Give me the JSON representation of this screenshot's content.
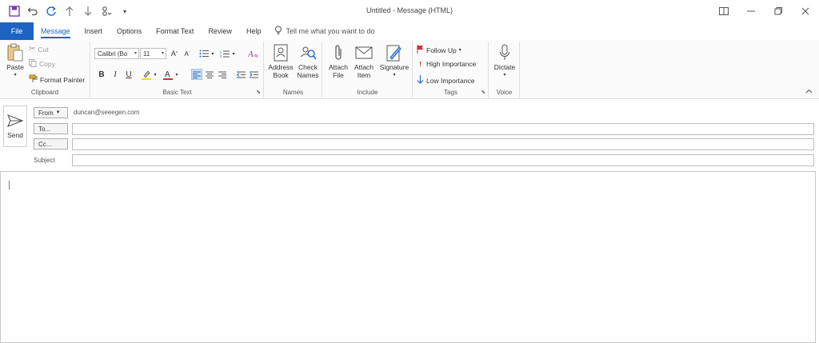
{
  "window": {
    "title": "Untitled  -  Message (HTML)"
  },
  "quick_access": {
    "icons": [
      "save-icon",
      "undo-icon",
      "redo-icon",
      "up-arrow-icon",
      "down-arrow-icon",
      "customize-icon"
    ]
  },
  "tabs": {
    "file": "File",
    "items": [
      "Message",
      "Insert",
      "Options",
      "Format Text",
      "Review",
      "Help"
    ],
    "active": "Message",
    "tell_me": "Tell me what you want to do"
  },
  "ribbon": {
    "clipboard": {
      "label": "Clipboard",
      "paste": "Paste",
      "cut": "Cut",
      "copy": "Copy",
      "format_painter": "Format Painter"
    },
    "basic_text": {
      "label": "Basic Text",
      "font_name": "Calibri (Bo",
      "font_size": "11"
    },
    "names": {
      "label": "Names",
      "address_book_1": "Address",
      "address_book_2": "Book",
      "check_names_1": "Check",
      "check_names_2": "Names"
    },
    "include": {
      "label": "Include",
      "attach_file_1": "Attach",
      "attach_file_2": "File",
      "attach_item_1": "Attach",
      "attach_item_2": "Item",
      "signature": "Signature"
    },
    "tags": {
      "label": "Tags",
      "follow_up": "Follow Up",
      "high_importance": "High Importance",
      "low_importance": "Low Importance"
    },
    "voice": {
      "label": "Voice",
      "dictate": "Dictate"
    },
    "colors": {
      "accent": "#1d63c2",
      "highlight": "#f5e400",
      "font_color": "#d32f2f",
      "flag": "#d32f2f"
    }
  },
  "header": {
    "send": "Send",
    "from_button": "From",
    "from_value": "duncan@seeegen.com",
    "to_button": "To...",
    "cc_button": "Cc...",
    "subject_label": "Subject",
    "to_value": "",
    "cc_value": "",
    "subject_value": ""
  },
  "body": {
    "text": ""
  }
}
